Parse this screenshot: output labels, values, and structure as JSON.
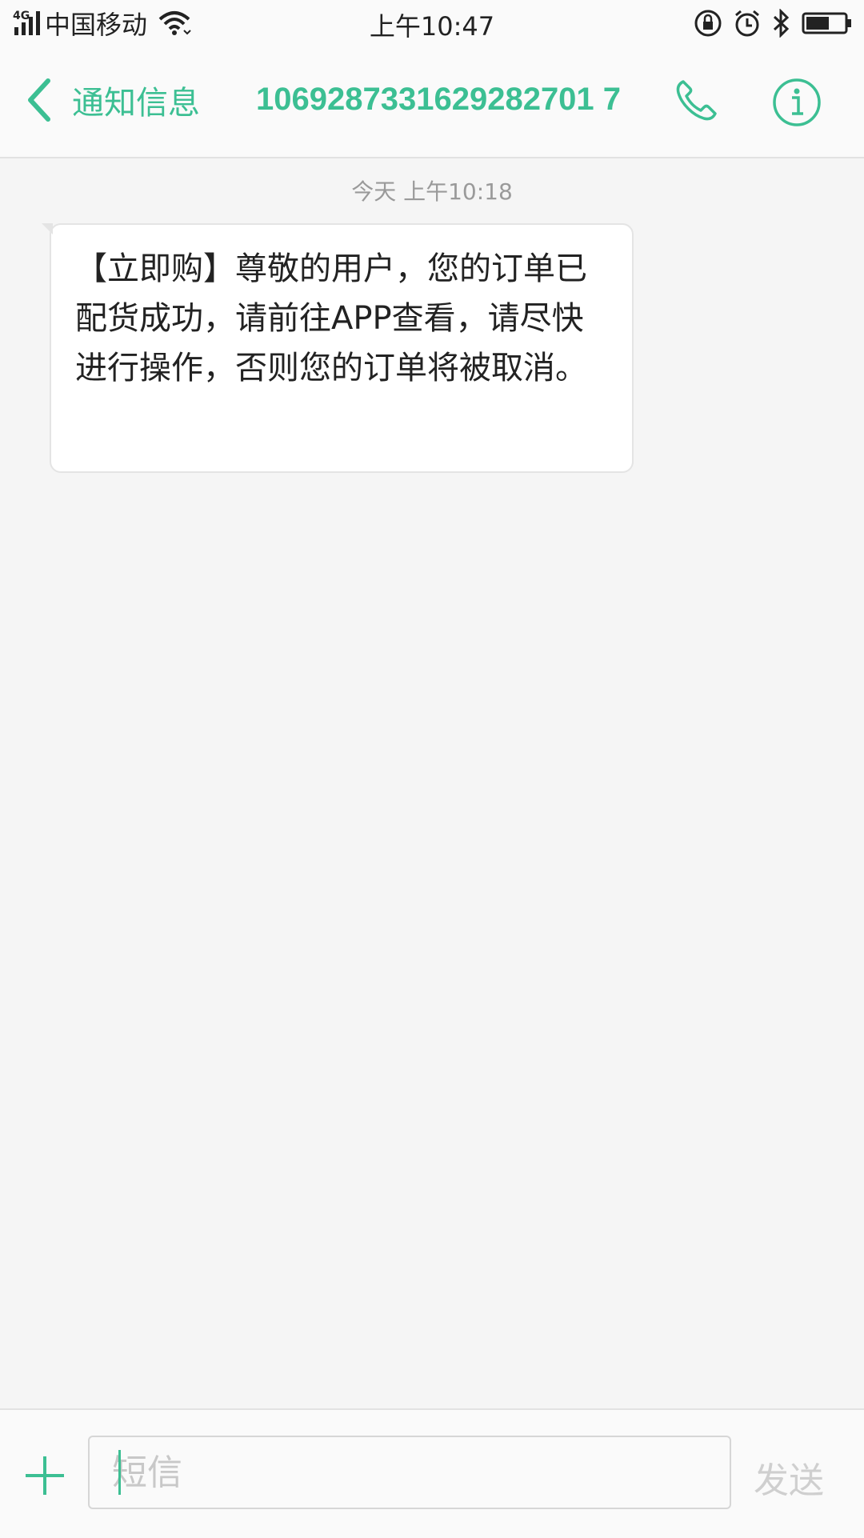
{
  "status_bar": {
    "network": "4G",
    "carrier": "中国移动",
    "time": "上午10:47",
    "icons": [
      "signal-icon",
      "wifi-icon",
      "rotation-lock-icon",
      "alarm-icon",
      "bluetooth-icon",
      "battery-icon"
    ],
    "battery_level": 0.6
  },
  "header": {
    "back_label": "通知信息",
    "phone_number": "1069287331629282701 7",
    "icons": [
      "back-chevron-icon",
      "phone-icon",
      "info-icon"
    ]
  },
  "conversation": {
    "timestamp": "今天 上午10:18",
    "messages": [
      {
        "text": "【立即购】尊敬的用户，您的订单已配货成功，请前往APP查看，请尽快进行操作，否则您的订单将被取消。"
      }
    ]
  },
  "composer": {
    "placeholder": "短信",
    "send_label": "发送",
    "icons": [
      "plus-icon"
    ]
  },
  "colors": {
    "accent": "#3cbf93",
    "background": "#f5f5f5",
    "bubble": "#ffffff"
  }
}
